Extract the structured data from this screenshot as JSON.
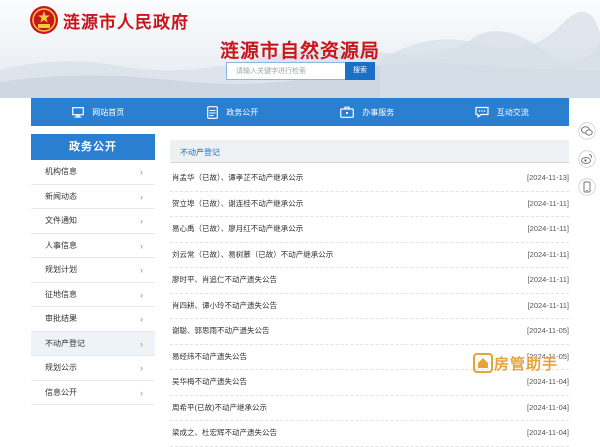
{
  "header": {
    "site_title": "涟源市人民政府",
    "bureau_title": "涟源市自然资源局",
    "search_placeholder": "请输入关键字进行检索",
    "search_button": "搜索"
  },
  "nav": {
    "items": [
      {
        "label": "网站首页",
        "icon": "monitor-icon"
      },
      {
        "label": "政务公开",
        "icon": "document-icon"
      },
      {
        "label": "办事服务",
        "icon": "briefcase-icon"
      },
      {
        "label": "互动交流",
        "icon": "chat-icon"
      }
    ]
  },
  "sidebar": {
    "title": "政务公开",
    "items": [
      {
        "label": "机构信息"
      },
      {
        "label": "新闻动态"
      },
      {
        "label": "文件通知"
      },
      {
        "label": "人事信息"
      },
      {
        "label": "规划计划"
      },
      {
        "label": "征地信息"
      },
      {
        "label": "审批结果"
      },
      {
        "label": "不动产登记",
        "active": true
      },
      {
        "label": "规划公示"
      },
      {
        "label": "信息公开"
      }
    ]
  },
  "main": {
    "section_title": "不动产登记",
    "rows": [
      {
        "title": "肖孟华（已故）、谭孝芷不动产继承公示",
        "date": "[2024-11-13]"
      },
      {
        "title": "贺立埠（已故）、谢连桂不动产继承公示",
        "date": "[2024-11-11]"
      },
      {
        "title": "易心禹（已故）、廖月红不动产继承公示",
        "date": "[2024-11-11]"
      },
      {
        "title": "刘云常（已故）、易树慕（已故）不动产继承公示",
        "date": "[2024-11-11]"
      },
      {
        "title": "廖时平、肖追仁不动产遗失公告",
        "date": "[2024-11-11]"
      },
      {
        "title": "肖四耕、谭小玲不动产遗失公告",
        "date": "[2024-11-11]"
      },
      {
        "title": "谢聪、郭思雨不动产遗失公告",
        "date": "[2024-11-05]"
      },
      {
        "title": "易经纬不动产遗失公告",
        "date": "[2024-11-05]"
      },
      {
        "title": "吴华梅不动产遗失公告",
        "date": "[2024-11-04]"
      },
      {
        "title": "周希平(已故)不动产继承公示",
        "date": "[2024-11-04]"
      },
      {
        "title": "梁成之、杜宏辉不动产遗失公告",
        "date": "[2024-11-04]"
      }
    ]
  },
  "float_toolbar": [
    "wechat-icon",
    "weibo-icon",
    "mobile-icon"
  ],
  "watermark": {
    "text": "房管助手",
    "icon": "house-logo-icon"
  },
  "colors": {
    "brand_red": "#c8161d",
    "nav_blue": "#2a7fd0",
    "search_blue": "#1b6fc6",
    "watermark_orange": "#e8a23a"
  }
}
